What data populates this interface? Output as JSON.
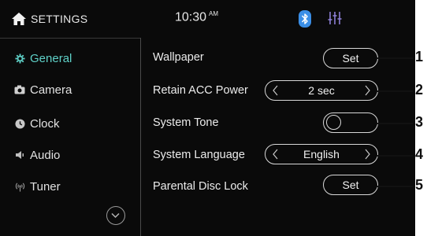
{
  "header": {
    "title": "SETTINGS",
    "time": "10:30",
    "ampm": "AM",
    "icons": [
      "home-icon",
      "bluetooth-icon",
      "equalizer-icon"
    ]
  },
  "sidebar": {
    "items": [
      {
        "label": "General",
        "icon": "gear-icon",
        "active": true
      },
      {
        "label": "Camera",
        "icon": "camera-icon",
        "active": false
      },
      {
        "label": "Clock",
        "icon": "clock-icon",
        "active": false
      },
      {
        "label": "Audio",
        "icon": "speaker-icon",
        "active": false
      },
      {
        "label": "Tuner",
        "icon": "antenna-icon",
        "active": false
      }
    ]
  },
  "settings": [
    {
      "label": "Wallpaper",
      "control": "button",
      "value": "Set",
      "callout": "1"
    },
    {
      "label": "Retain ACC Power",
      "control": "selector",
      "value": "2 sec",
      "callout": "2"
    },
    {
      "label": "System Tone",
      "control": "toggle",
      "value": "off",
      "callout": "3"
    },
    {
      "label": "System Language",
      "control": "selector",
      "value": "English",
      "callout": "4"
    },
    {
      "label": "Parental Disc Lock",
      "control": "button",
      "value": "Set",
      "callout": "5"
    }
  ],
  "colors": {
    "background": "#0a0a0a",
    "accent": "#5fd1c8",
    "bluetooth": "#3a8ee6"
  }
}
